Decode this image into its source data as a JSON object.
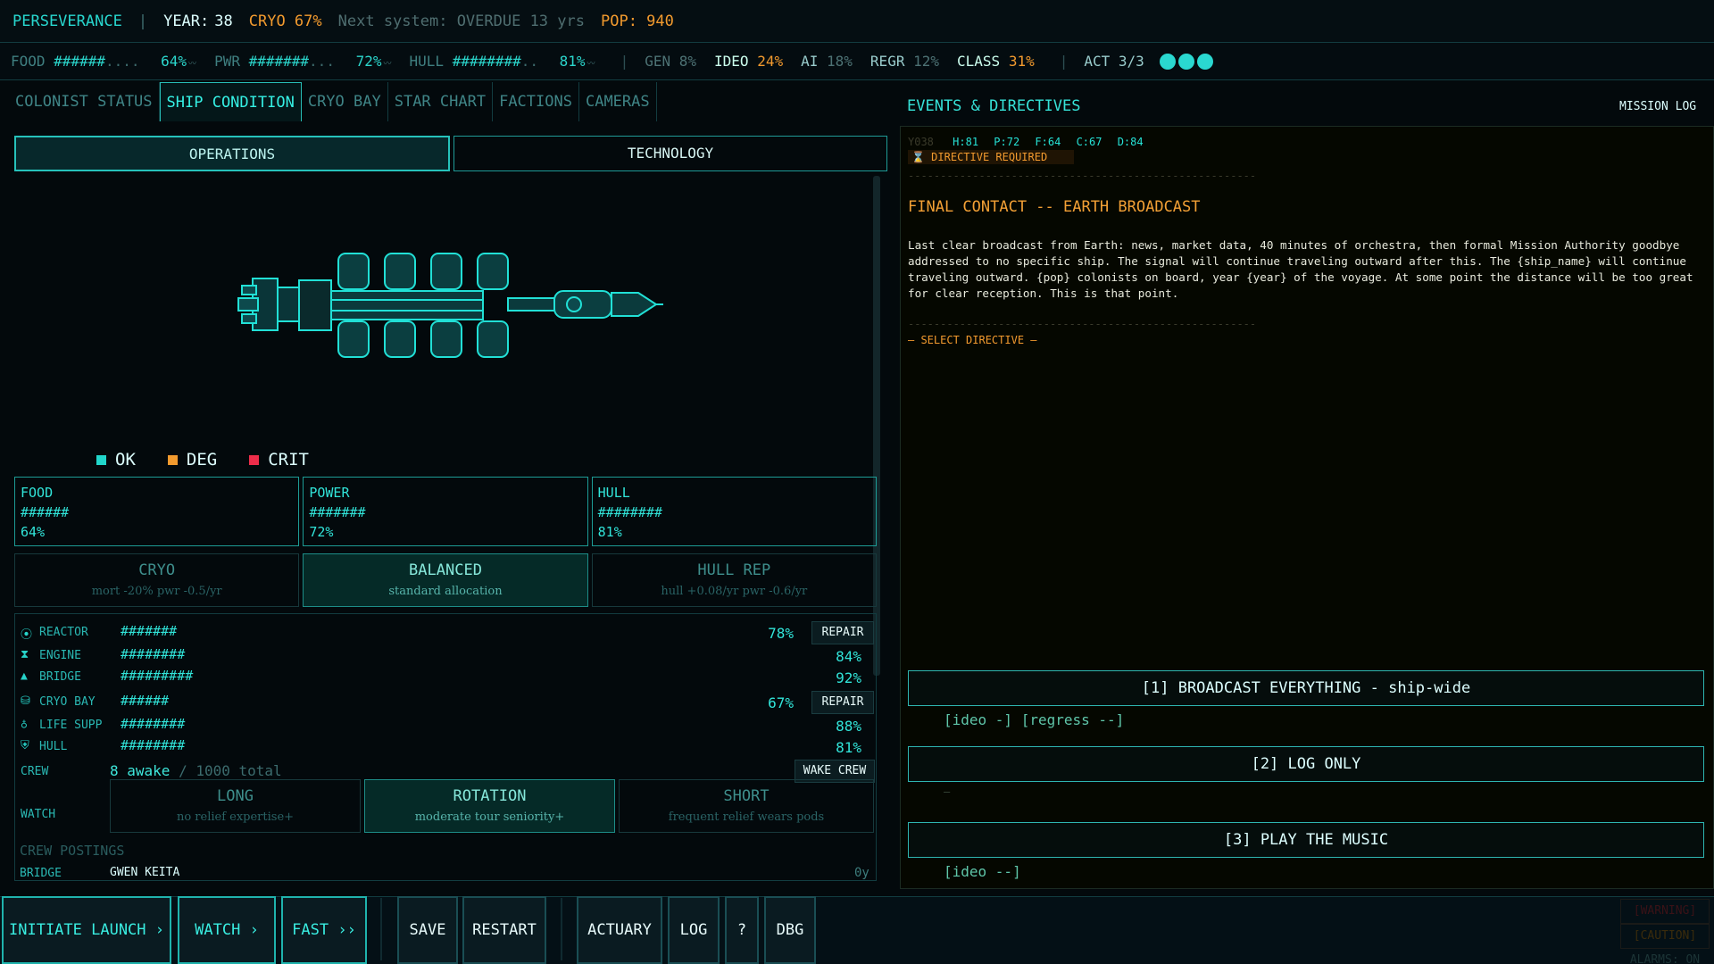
{
  "header": {
    "ship_name": "PERSEVERANCE",
    "divider": "|",
    "year_label": "YEAR:",
    "year_value": "38",
    "cryo": "CRYO 67%",
    "next_system": "Next system: OVERDUE 13 yrs",
    "pop": "POP: 940"
  },
  "stats": {
    "food": {
      "label": "FOOD",
      "bar": "######",
      "dots": "....",
      "pct": "64%",
      "spark": "〰"
    },
    "pwr": {
      "label": "PWR",
      "bar": "#######",
      "dots": "...",
      "pct": "72%",
      "spark": "〰"
    },
    "hull": {
      "label": "HULL",
      "bar": "########",
      "dots": "..",
      "pct": "81%",
      "spark": "〰"
    },
    "gen": {
      "label": "GEN",
      "value": "8%"
    },
    "ideo": {
      "label": "IDEO",
      "value": "24%"
    },
    "ai": {
      "label": "AI",
      "value": "18%"
    },
    "regr": {
      "label": "REGR",
      "value": "12%"
    },
    "class": {
      "label": "CLASS",
      "value": "31%"
    },
    "act": "ACT 3/3",
    "act_count": 3
  },
  "tabs": [
    "COLONIST STATUS",
    "SHIP CONDITION",
    "CRYO BAY",
    "STAR CHART",
    "FACTIONS",
    "CAMERAS"
  ],
  "active_tab": 1,
  "subtabs": [
    "OPERATIONS",
    "TECHNOLOGY"
  ],
  "legend": [
    {
      "label": "OK",
      "color": "#21d6cb"
    },
    {
      "label": "DEG",
      "color": "#f29a2e"
    },
    {
      "label": "CRIT",
      "color": "#ee2d4a"
    }
  ],
  "resources": [
    {
      "name": "FOOD",
      "bar": "######",
      "pct": "64%"
    },
    {
      "name": "POWER",
      "bar": "#######",
      "pct": "72%"
    },
    {
      "name": "HULL",
      "bar": "########",
      "pct": "81%"
    }
  ],
  "allocation": [
    {
      "title": "CRYO",
      "sub": "mort -20%  pwr -0.5/yr"
    },
    {
      "title": "BALANCED",
      "sub": "standard allocation"
    },
    {
      "title": "HULL REP",
      "sub": "hull +0.08/yr  pwr -0.6/yr"
    }
  ],
  "systems": [
    {
      "name": "REACTOR",
      "bar": "#######",
      "pct": "78%",
      "repair": "REPAIR",
      "icon": "⦿"
    },
    {
      "name": "ENGINE",
      "bar": "########",
      "pct": "84%",
      "icon": "⧗"
    },
    {
      "name": "BRIDGE",
      "bar": "#########",
      "pct": "92%",
      "icon": "▲"
    },
    {
      "name": "CRYO BAY",
      "bar": "######",
      "pct": "67%",
      "repair": "REPAIR",
      "icon": "⛁"
    },
    {
      "name": "LIFE SUPP",
      "bar": "########",
      "pct": "88%",
      "icon": "♁"
    },
    {
      "name": "HULL",
      "bar": "########",
      "pct": "81%",
      "icon": "⛨"
    }
  ],
  "crew": {
    "label": "CREW",
    "awake": "8 awake",
    "total": " / 1000 total",
    "wake": "WAKE CREW"
  },
  "watch": {
    "label": "WATCH",
    "options": [
      {
        "title": "LONG",
        "sub": "no relief   expertise+"
      },
      {
        "title": "ROTATION",
        "sub": "moderate tour   seniority+"
      },
      {
        "title": "SHORT",
        "sub": "frequent relief   wears pods"
      }
    ]
  },
  "postings": {
    "title": "CREW POSTINGS",
    "station": "BRIDGE",
    "name": "GWEN KEITA",
    "tenure": "0y"
  },
  "events": {
    "title": "EVENTS & DIRECTIVES",
    "mission_log": "MISSION LOG",
    "stamp": "Y038",
    "h": "H:81",
    "p": "P:72",
    "f": "F:64",
    "c": "C:67",
    "d": "D:84",
    "directive_required": "⌛  DIRECTIVE REQUIRED",
    "dashes": "------------------------------------------------------",
    "event_title": "FINAL CONTACT -- EARTH BROADCAST",
    "event_body": "Last clear broadcast from Earth: news, market data, 40 minutes of orchestra, then formal Mission Authority goodbye addressed to no specific ship. The signal will continue traveling outward after this. The {ship_name} will continue traveling outward. {pop} colonists on board, year {year} of the voyage. At some point the distance will be too great for clear reception. This is that point.",
    "select_directive": "— SELECT DIRECTIVE —",
    "options": [
      {
        "label": "[1]  BROADCAST EVERYTHING - ship-wide",
        "tags": "[ideo -]  [regress --]"
      },
      {
        "label": "[2]  LOG ONLY",
        "tags": "—"
      },
      {
        "label": "[3]  PLAY THE MUSIC",
        "tags": "[ideo --]"
      }
    ]
  },
  "bottom": {
    "launch": "INITIATE LAUNCH ›",
    "watch": "WATCH ›",
    "fast": "FAST ››",
    "save": "SAVE",
    "restart": "RESTART",
    "actuary": "ACTUARY",
    "log": "LOG",
    "help": "?",
    "dbg": "DBG",
    "warning": "[WARNING]",
    "caution": "[CAUTION]",
    "alarms": "ALARMS: ON"
  },
  "colors": {
    "accent": "#27d3c9",
    "warn": "#f29a2e",
    "crit": "#ee2d4a"
  }
}
